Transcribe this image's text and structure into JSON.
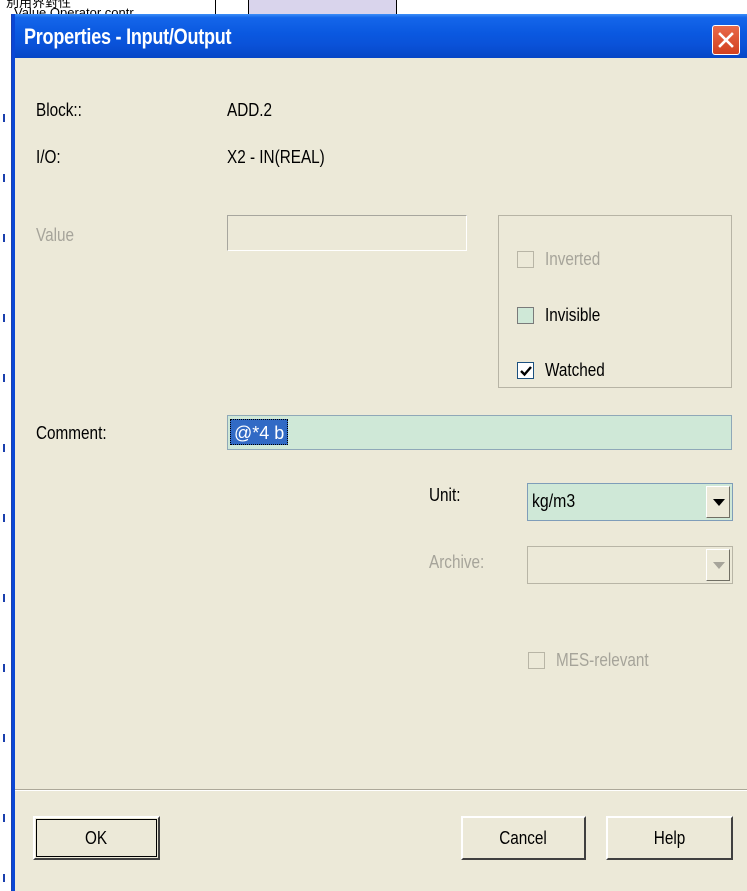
{
  "background": {
    "caption_line1": "別用界對性",
    "caption_line2": "Value Operator contr"
  },
  "dialog": {
    "title": "Properties - Input/Output",
    "block_label": "Block::",
    "block_value": "ADD.2",
    "io_label": "I/O:",
    "io_value": "X2 - IN(REAL)",
    "value_label": "Value",
    "value_field": "",
    "checkboxes": {
      "inverted": {
        "label": "Inverted",
        "checked": false,
        "enabled": false
      },
      "invisible": {
        "label": "Invisible",
        "checked": false,
        "enabled": true
      },
      "watched": {
        "label": "Watched",
        "checked": true,
        "enabled": true
      }
    },
    "comment_label": "Comment:",
    "comment_value": "@*4 b",
    "unit_label": "Unit:",
    "unit_value": "kg/m3",
    "archive_label": "Archive:",
    "archive_value": "",
    "mes_label": "MES-relevant",
    "buttons": {
      "ok": "OK",
      "cancel": "Cancel",
      "help": "Help"
    }
  },
  "colors": {
    "titlebar": "#0a58e0",
    "dialog_bg": "#ece9d8",
    "field_highlight": "#cfe8d7",
    "selection": "#316ac5",
    "close_button": "#d2401f"
  }
}
